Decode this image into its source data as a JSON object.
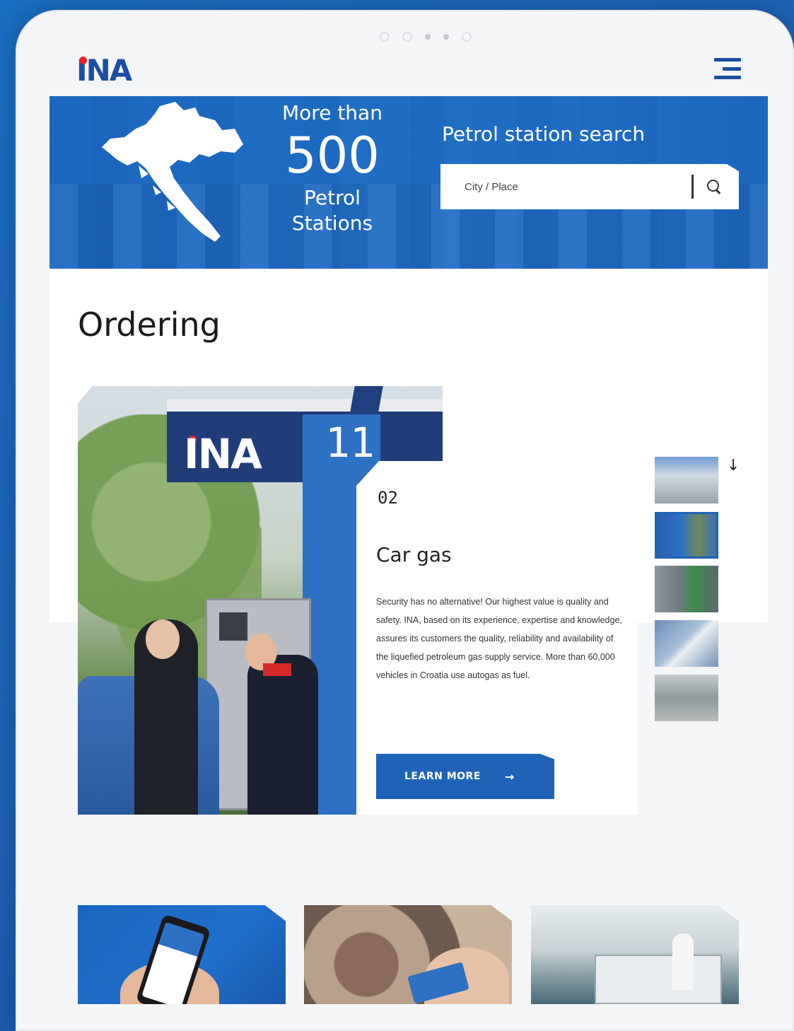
{
  "header": {
    "logo_text": "INA",
    "menu_icon": "hamburger-menu-icon"
  },
  "hero": {
    "stat_pre": "More than",
    "stat_number": "500",
    "stat_line1": "Petrol",
    "stat_line2": "Stations",
    "search_title": "Petrol station search",
    "search_placeholder": "City / Place",
    "search_icon": "search-icon"
  },
  "section": {
    "title": "Ordering"
  },
  "feature": {
    "photo_brand": "INA",
    "photo_pump_number": "11",
    "index": "02",
    "title": "Car gas",
    "text": "Security has no alternative! Our highest value is quality and safety. INA, based on its experience, expertise and knowledge, assures its customers the quality, reliability and availability of the liquefied petroleum gas supply service. More than 60,000 vehicles in Croatia use autogas as fuel.",
    "button_label": "LEARN MORE",
    "button_arrow": "→"
  },
  "thumbnails": {
    "active_index": 2,
    "down_arrow": "↓"
  },
  "colors": {
    "brand_blue": "#1f63b8",
    "hero_blue": "#1c67c0",
    "logo_red": "#e3232b"
  }
}
